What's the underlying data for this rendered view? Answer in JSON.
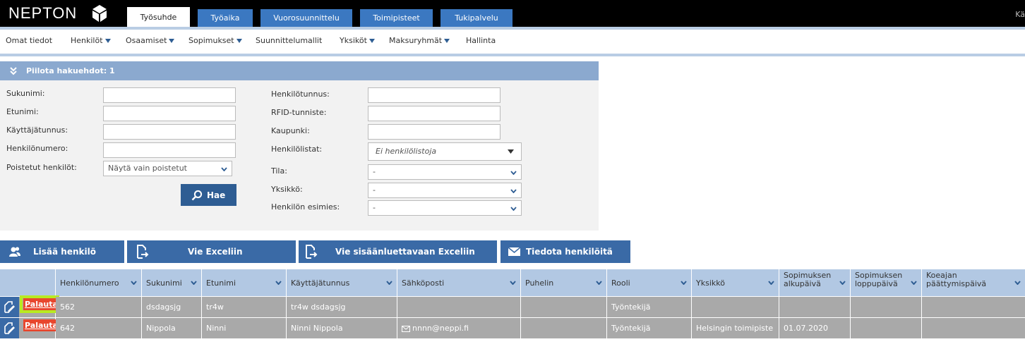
{
  "app": {
    "logo_text": "NEPTON",
    "topright_text": "Kä"
  },
  "tabs": [
    {
      "label": "Työsuhde",
      "active": true
    },
    {
      "label": "Työaika"
    },
    {
      "label": "Vuorosuunnittelu"
    },
    {
      "label": "Toimipisteet"
    },
    {
      "label": "Tukipalvelu"
    }
  ],
  "nav": [
    {
      "label": "Omat tiedot"
    },
    {
      "label": "Henkilöt"
    },
    {
      "label": "Osaamiset"
    },
    {
      "label": "Sopimukset"
    },
    {
      "label": "Suunnittelumallit"
    },
    {
      "label": "Yksiköt"
    },
    {
      "label": "Maksuryhmät"
    },
    {
      "label": "Hallinta"
    }
  ],
  "search": {
    "toggle_label": "Piilota hakuehdot: 1",
    "left_fields": [
      {
        "label": "Sukunimi:",
        "value": ""
      },
      {
        "label": "Etunimi:",
        "value": ""
      },
      {
        "label": "Käyttäjätunnus:",
        "value": ""
      },
      {
        "label": "Henkilönumero:",
        "value": ""
      }
    ],
    "deleted": {
      "label": "Poistetut henkilöt:",
      "value": "Näytä vain poistetut"
    },
    "search_button": "Hae",
    "right_fields": [
      {
        "label": "Henkilötunnus:",
        "value": ""
      },
      {
        "label": "RFID-tunniste:",
        "value": ""
      },
      {
        "label": "Kaupunki:",
        "value": ""
      }
    ],
    "lists": {
      "label": "Henkilölistat:",
      "value": "Ei henkilölistoja"
    },
    "selects": [
      {
        "label": "Tila:",
        "value": "-"
      },
      {
        "label": "Yksikkö:",
        "value": "-"
      },
      {
        "label": "Henkilön esimies:",
        "value": "-"
      }
    ]
  },
  "actions": {
    "add": "Lisää henkilö",
    "excel": "Vie Exceliin",
    "excel_import": "Vie sisäänluettavaan Exceliin",
    "notify": "Tiedota henkilöitä"
  },
  "table": {
    "columns": [
      {
        "label": "Henkilönumero"
      },
      {
        "label": "Sukunimi"
      },
      {
        "label": "Etunimi"
      },
      {
        "label": "Käyttäjätunnus"
      },
      {
        "label": "Sähköposti"
      },
      {
        "label": "Puhelin"
      },
      {
        "label": "Rooli"
      },
      {
        "label": "Yksikkö"
      },
      {
        "label": "Sopimuksen alkupäivä"
      },
      {
        "label": "Sopimuksen loppupäivä"
      },
      {
        "label": "Koeajan päättymispäivä"
      }
    ],
    "restore_label": "Palauta",
    "rows": [
      {
        "cells": [
          "562",
          "dsdagsjg",
          "tr4w",
          "tr4w dsdagsjg",
          "",
          "",
          "Työntekijä",
          "",
          "",
          "",
          ""
        ]
      },
      {
        "cells": [
          "642",
          "Nippola",
          "Ninni",
          "Ninni Nippola",
          "nnnn@neppi.fi",
          "",
          "Työntekijä",
          "Helsingin toimipiste",
          "01.07.2020",
          "",
          ""
        ]
      }
    ]
  },
  "colors": {
    "accent": "#3a6aa6",
    "header": "#b2c8e3",
    "highlight": "#b8ea21",
    "restore": "#e8472e"
  }
}
